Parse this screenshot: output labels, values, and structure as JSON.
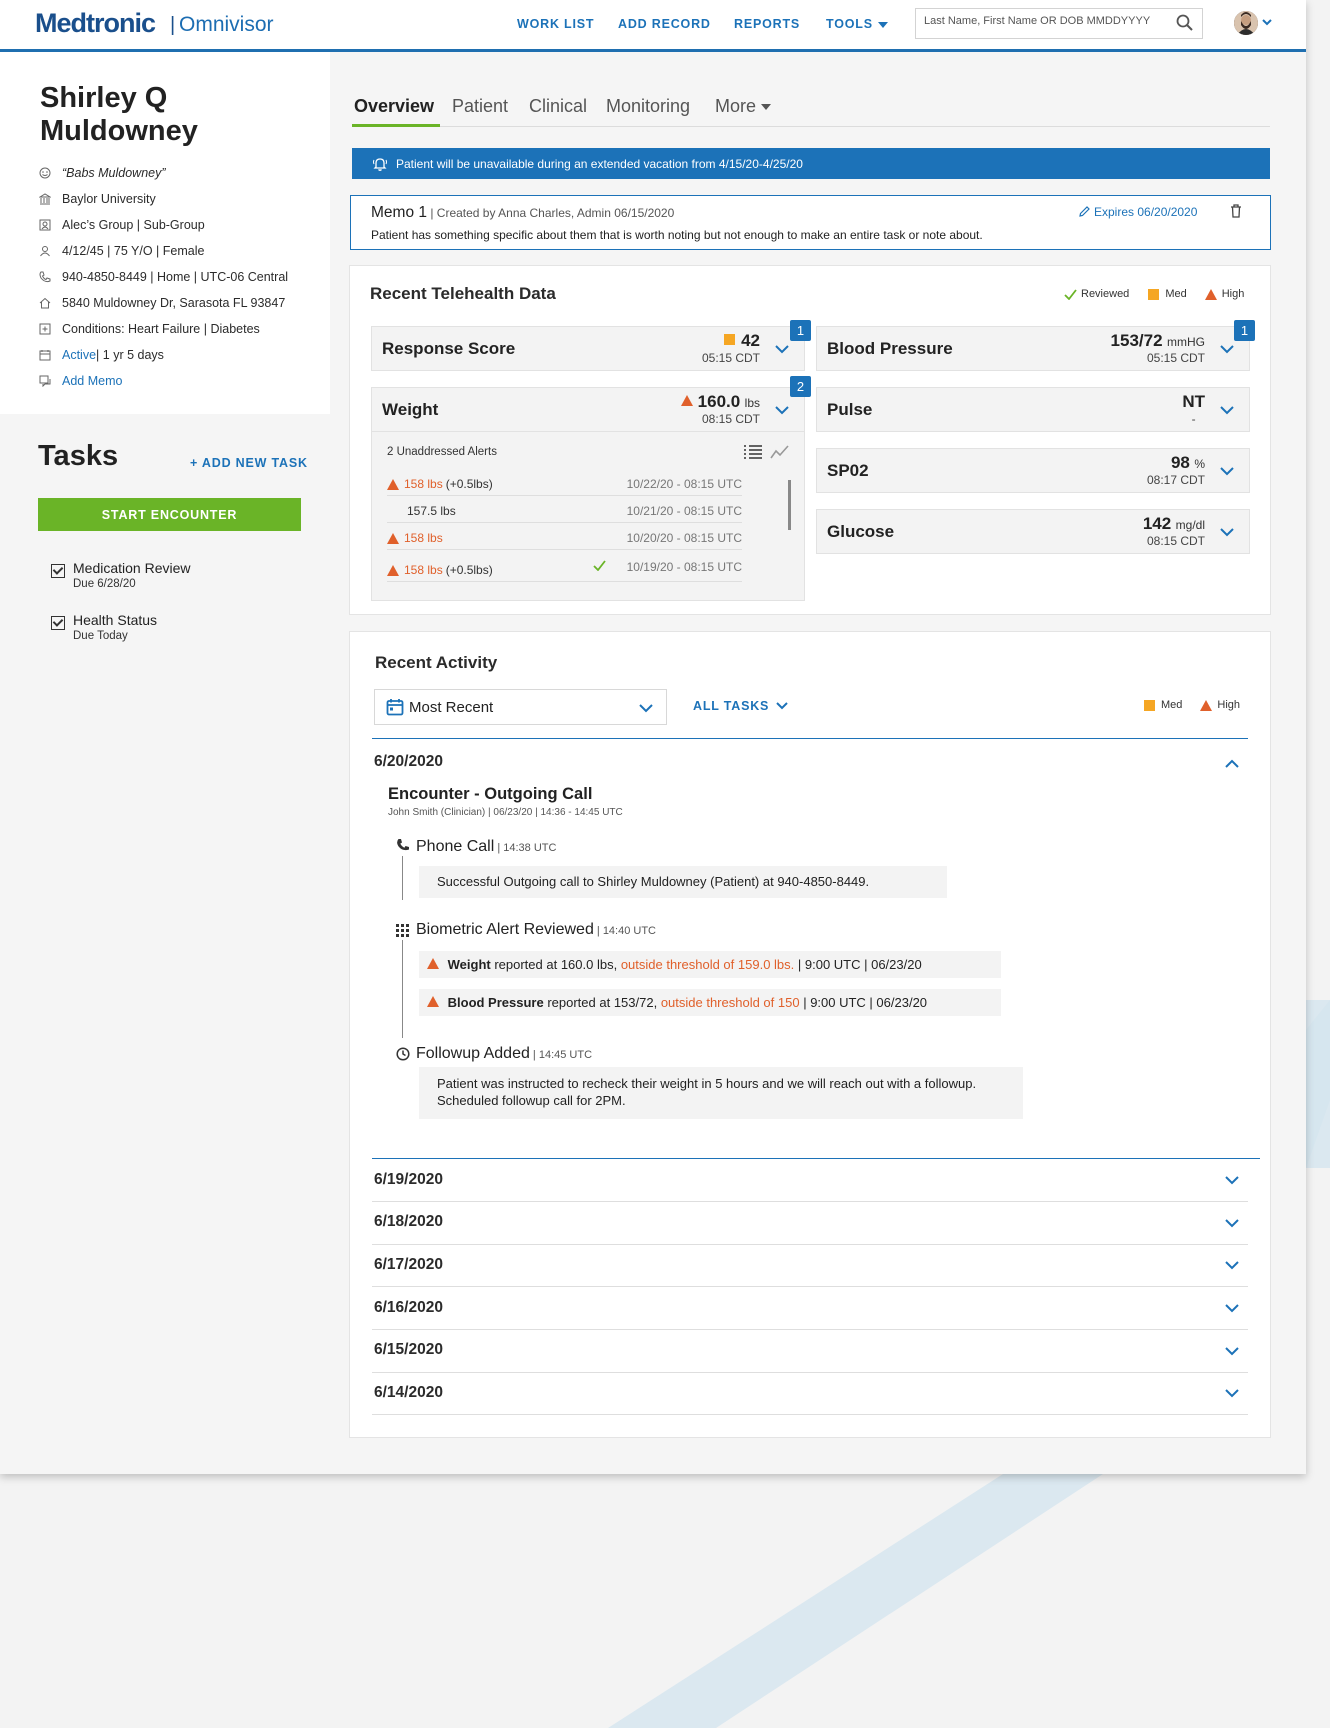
{
  "header": {
    "logo_brand": "Medtronic",
    "logo_separator": "|",
    "logo_product": "Omnivisor",
    "nav": [
      "WORK LIST",
      "ADD RECORD",
      "REPORTS",
      "TOOLS"
    ],
    "search_placeholder": "Last Name, First Name OR DOB MMDDYYYY",
    "icons": [
      "search-icon",
      "user-avatar",
      "chevron-down-icon"
    ]
  },
  "patient": {
    "name": "Shirley Q Muldowney",
    "nickname": "“Babs Muldowney”",
    "organization": "Baylor University",
    "group": "Alec’s Group | Sub-Group",
    "dob": "4/12/45 | 75 Y/O | Female",
    "phone": "940-4850-8449 | Home | UTC-06 Central",
    "address": "5840 Muldowney Dr, Sarasota FL 93847",
    "conditions": "Conditions: Heart Failure | Diabetes",
    "status_link": "Active",
    "status_duration": " | 1 yr 5 days",
    "add_memo": "Add Memo"
  },
  "tasks": {
    "title": "Tasks",
    "add_label": "+ ADD NEW TASK",
    "start_label": "START ENCOUNTER",
    "items": [
      {
        "name": "Medication Review",
        "due": "Due 6/28/20"
      },
      {
        "name": "Health Status",
        "due": "Due Today"
      }
    ]
  },
  "tabs": [
    "Overview",
    "Patient",
    "Clinical",
    "Monitoring",
    "More"
  ],
  "banner": {
    "text": "Patient will be unavailable during an extended vacation from  4/15/20-4/25/20"
  },
  "memo": {
    "title": "Memo 1",
    "meta": " | Created by Anna Charles, Admin 06/15/2020",
    "body": "Patient has something specific about them that is worth noting but not enough to make an entire task or note about.",
    "expires": "Expires 06/20/2020"
  },
  "telehealth": {
    "title": "Recent Telehealth Data",
    "legend": [
      "Reviewed",
      "Med",
      "High"
    ],
    "metrics": {
      "response": {
        "name": "Response Score",
        "value": "42",
        "unit": "",
        "time": "05:15 CDT",
        "badge": "1"
      },
      "weight": {
        "name": "Weight",
        "value": "160.0",
        "unit": "lbs",
        "time": "08:15 CDT",
        "badge": "2"
      },
      "bp": {
        "name": "Blood Pressure",
        "value": "153/72",
        "unit": "mmHG",
        "time": "05:15 CDT",
        "badge": "1"
      },
      "pulse": {
        "name": "Pulse",
        "value": "NT",
        "unit": "",
        "time": "-"
      },
      "spo2": {
        "name": "SP02",
        "value": "98",
        "unit": "%",
        "time": "08:17 CDT"
      },
      "glucose": {
        "name": "Glucose",
        "value": "142",
        "unit": "mg/dl",
        "time": "08:15 CDT"
      }
    },
    "alerts": {
      "title": "2 Unaddressed Alerts",
      "rows": [
        {
          "value": "158 lbs",
          "extra": "(+0.5lbs)",
          "date": "10/22/20 - 08:15 UTC"
        },
        {
          "value": "157.5 lbs",
          "extra": "",
          "date": "10/21/20 - 08:15 UTC"
        },
        {
          "value": "158 lbs",
          "extra": "",
          "date": "10/20/20 - 08:15 UTC"
        },
        {
          "value": "158 lbs",
          "extra": "(+0.5lbs)",
          "date": "10/19/20 - 08:15 UTC"
        }
      ]
    }
  },
  "activity": {
    "title": "Recent Activity",
    "filter": "Most Recent",
    "all_tasks": "ALL TASKS",
    "legend": [
      "Med",
      "High"
    ],
    "open_date": "6/20/2020",
    "encounter_title": "Encounter - Outgoing Call",
    "encounter_meta": "John Smith (Clinician) | 06/23/20 | 14:36 - 14:45 UTC",
    "steps": {
      "call": {
        "label": "Phone Call",
        "time": " | 14:38 UTC",
        "note": "Successful Outgoing call to Shirley Muldowney (Patient) at 940-4850-8449."
      },
      "bio": {
        "label": "Biometric Alert Reviewed",
        "time": " | 14:40 UTC",
        "a1": {
          "metric": "Weight",
          "text": " reported at 160.0 lbs, ",
          "warn": "outside threshold of 159.0 lbs.",
          "tail": " | 9:00 UTC | 06/23/20"
        },
        "a2": {
          "metric": "Blood Pressure",
          "text": " reported at 153/72, ",
          "warn": "outside threshold of 150",
          "tail": " | 9:00 UTC | 06/23/20"
        }
      },
      "follow": {
        "label": "Followup Added",
        "time": " | 14:45 UTC",
        "note": "Patient was instructed to recheck their weight in 5 hours and we will reach out with a followup. Scheduled followup call for 2PM."
      }
    },
    "collapsed_dates": [
      "6/19/2020",
      "6/18/2020",
      "6/17/2020",
      "6/16/2020",
      "6/15/2020",
      "6/14/2020"
    ]
  },
  "colors": {
    "brand_blue": "#1c72b8",
    "accent_green": "#6ab427",
    "med": "#f5a623",
    "high": "#e0602b"
  }
}
